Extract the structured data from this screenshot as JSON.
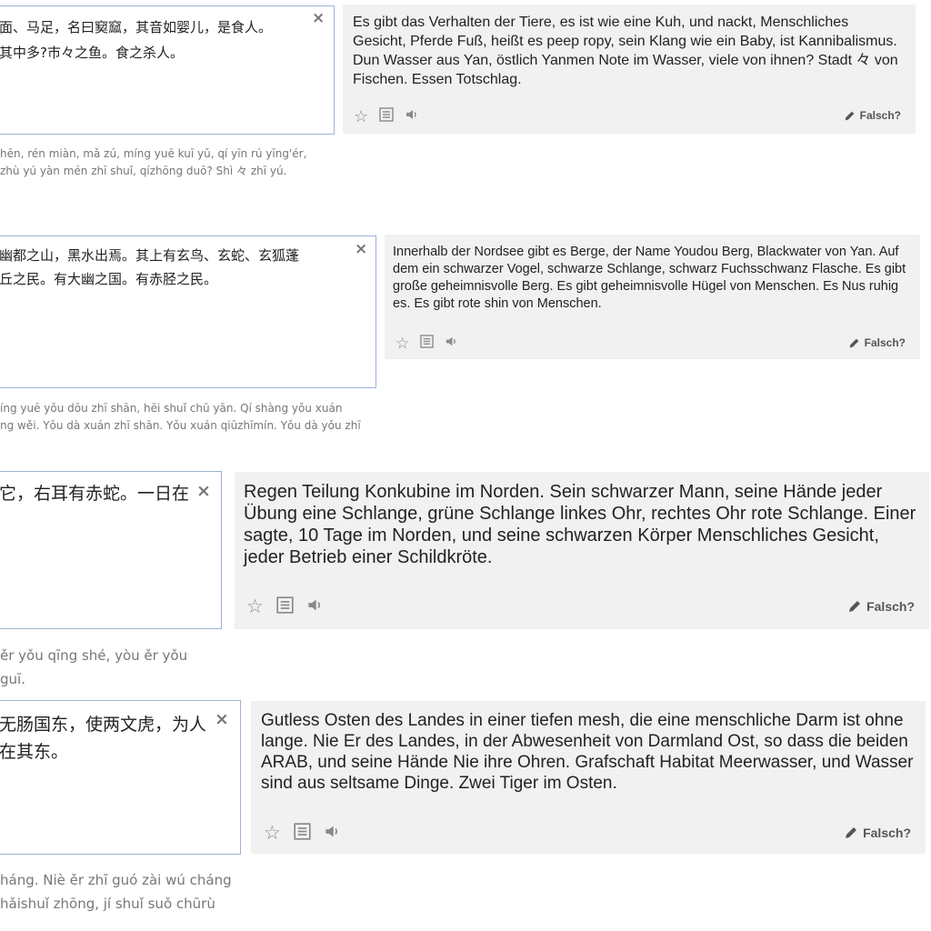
{
  "icons": {
    "close": "×",
    "star": "☆",
    "list": "list-icon",
    "speaker": "speaker-icon",
    "pencil": "pencil-icon"
  },
  "colors": {
    "input_border": "#9eb3d6",
    "output_bg": "#f1f1f1",
    "translit_text": "#777777"
  },
  "blocks": [
    {
      "source": "面、马足，名曰窫窳，其音如婴儿，是食人。\n其中多?市々之鱼。食之杀人。",
      "transliteration": "hēn, rén miàn, mǎ zú, míng yuē kuī yǔ, qí yīn rú yīng'ér,\nzhù yú yàn mén zhī shuǐ, qízhōng duō? Shì 々 zhī yú.",
      "translation": "Es gibt das Verhalten der Tiere, es ist wie eine Kuh, und nackt, Menschliches Gesicht, Pferde Fuß, heißt es peep ropy, sein Klang wie ein Baby, ist Kannibalismus. Dun Wasser aus Yan, östlich Yanmen Note im Wasser, viele von ihnen? Stadt 々 von Fischen. Essen Totschlag.",
      "wrong_label": "Falsch?"
    },
    {
      "source": "幽都之山，黑水出焉。其上有玄鸟、玄蛇、玄狐蓬\n丘之民。有大幽之国。有赤胫之民。",
      "transliteration": "íng yuē yǒu dōu zhī shān, hēi shuǐ chū yān. Qí shàng yǒu xuán\nng wěi. Yǒu dà xuán zhī shān. Yǒu xuán qiūzhīmín. Yǒu dà yǒu zhī",
      "translation": "Innerhalb der Nordsee gibt es Berge, der Name Youdou Berg, Blackwater von Yan. Auf dem ein schwarzer Vogel, schwarze Schlange, schwarz Fuchsschwanz Flasche. Es gibt große geheimnisvolle Berg. Es gibt geheimnisvolle Hügel von Menschen. Es Nus ruhig es. Es gibt rote shin von Menschen.",
      "wrong_label": "Falsch?"
    },
    {
      "source": "它，右耳有赤蛇。一日在",
      "transliteration": "ěr yǒu qīng shé, yòu ěr yǒu\nguī.",
      "translation": "Regen Teilung Konkubine im Norden. Sein schwarzer Mann, seine Hände jeder Übung eine Schlange, grüne Schlange linkes Ohr, rechtes Ohr rote Schlange. Einer sagte, 10 Tage im Norden, und seine schwarzen Körper Menschliches Gesicht, jeder Betrieb einer Schildkröte.",
      "wrong_label": "Falsch?"
    },
    {
      "source": "无肠国东，使两文虎，为人\n在其东。",
      "transliteration": "háng. Niè ěr zhī guó zài wú cháng\nhǎishuǐ zhōng, jí shuǐ suǒ chūrù",
      "translation": "Gutless Osten des Landes in einer tiefen mesh, die eine menschliche Darm ist ohne lange. Nie Er des Landes, in der Abwesenheit von Darmland Ost, so dass die beiden ARAB, und seine Hände Nie ihre Ohren. Grafschaft Habitat Meerwasser, und Wasser sind aus seltsame Dinge. Zwei Tiger im Osten.",
      "wrong_label": "Falsch?"
    }
  ]
}
